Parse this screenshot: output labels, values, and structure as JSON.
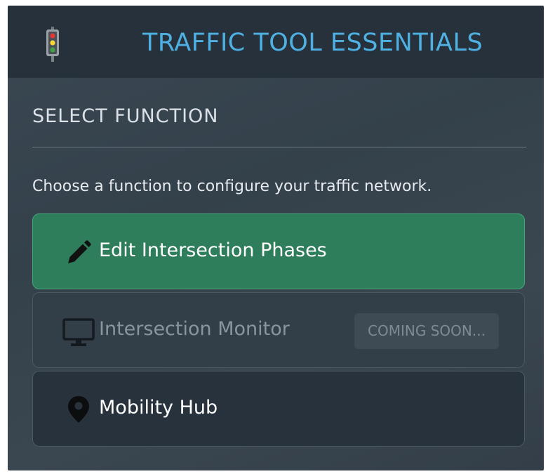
{
  "header": {
    "title": "TRAFFIC TOOL ESSENTIALS",
    "icon": "traffic-light-icon"
  },
  "section": {
    "title": "SELECT FUNCTION",
    "description": "Choose a function to configure your traffic network."
  },
  "options": [
    {
      "label": "Edit Intersection Phases",
      "icon": "pencil-icon",
      "state": "selected"
    },
    {
      "label": "Intersection Monitor",
      "icon": "monitor-icon",
      "state": "disabled",
      "badge": "COMING SOON..."
    },
    {
      "label": "Mobility Hub",
      "icon": "map-pin-icon",
      "state": "default"
    }
  ],
  "colors": {
    "accent_title": "#4fb1e3",
    "selected_bg": "#2e7d5b",
    "selected_border": "#46a77a"
  }
}
